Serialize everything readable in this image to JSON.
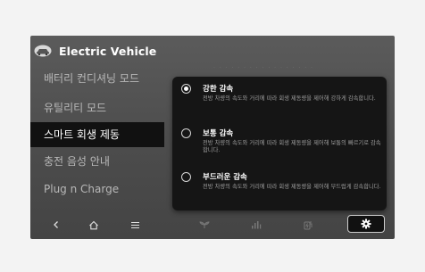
{
  "header": {
    "title": "Electric Vehicle",
    "icon": "ev-car-icon"
  },
  "menu": {
    "items": [
      {
        "label": "배터리 컨디셔닝 모드",
        "active": false
      },
      {
        "label": "유틸리티 모드",
        "active": false
      },
      {
        "label": "스마트 회생 제동",
        "active": true
      },
      {
        "label": "충전 음성 안내",
        "active": false
      },
      {
        "label": "Plug n Charge",
        "active": false
      }
    ]
  },
  "popup": {
    "options": [
      {
        "title": "강한 감속",
        "description": "전방 차량의 속도와 거리에 따라 회생 제동량을 제어해 강하게 감속합니다.",
        "selected": true
      },
      {
        "title": "보통 감속",
        "description": "전방 차량의 속도와 거리에 따라 회생 제동량을 제어해 보통의 빠르기로 감속합니다.",
        "selected": false
      },
      {
        "title": "부드러운 감속",
        "description": "전방 차량의 속도와 거리에 따라 회생 제동량을 제어해 부드럽게 감속합니다.",
        "selected": false
      }
    ]
  },
  "bottom_bar": {
    "icons": [
      "back-icon",
      "home-icon",
      "menu-icon",
      "eco-icon",
      "energy-bars-icon",
      "charging-icon",
      "gear-icon"
    ]
  },
  "colors": {
    "active_bg": "#111111",
    "popup_bg": "#151515",
    "text_muted": "#b8b8b8"
  }
}
